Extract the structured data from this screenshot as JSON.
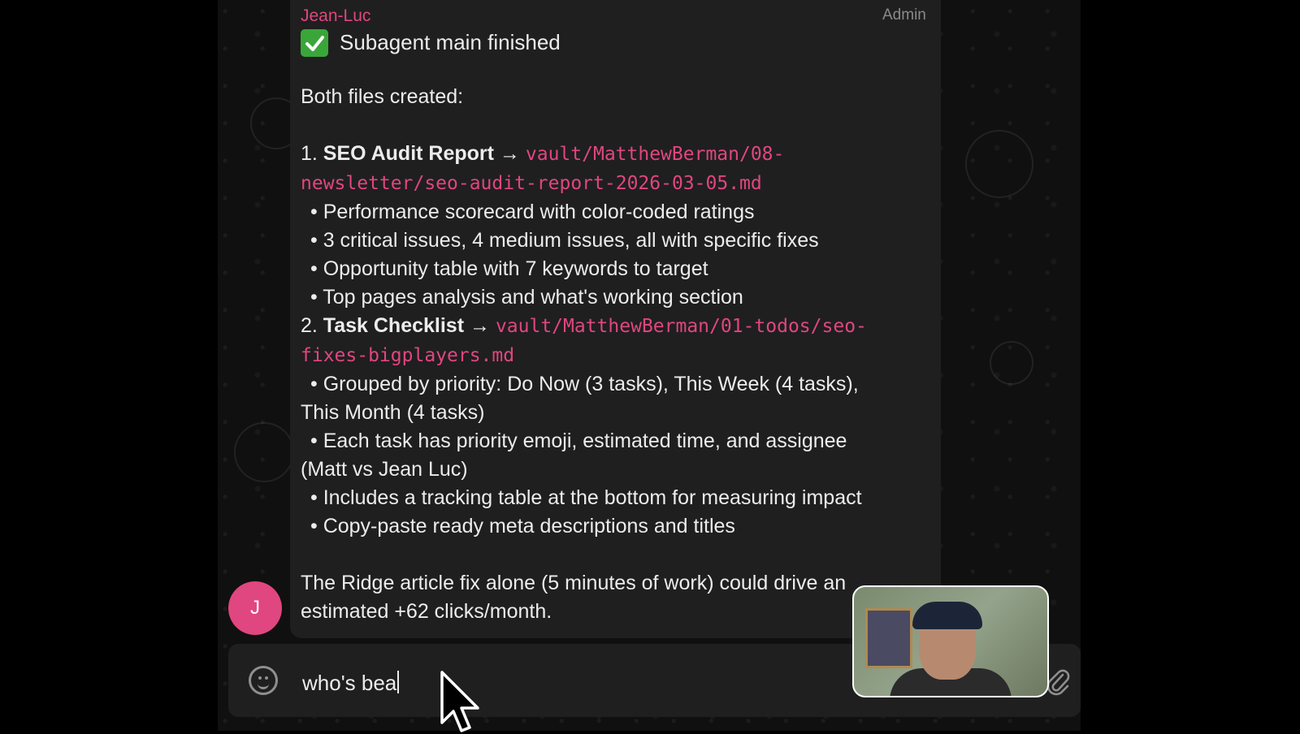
{
  "message": {
    "sender": "Jean-Luc",
    "role": "Admin",
    "status_icon": "check-mark-icon",
    "status_text": "Subagent main finished",
    "intro": "Both files created:",
    "item1_prefix": "1. ",
    "item1_title": "SEO Audit Report",
    "item1_arrow": " → ",
    "item1_path": "vault/MatthewBerman/08-newsletter/seo-audit-report-2026-03-05.md",
    "item1_bullets": [
      "• Performance scorecard with color-coded ratings",
      "• 3 critical issues, 4 medium issues, all with specific fixes",
      "• Opportunity table with 7 keywords to target",
      "• Top pages analysis and what's working section"
    ],
    "item2_prefix": "2. ",
    "item2_title": "Task Checklist",
    "item2_arrow": " → ",
    "item2_path": "vault/MatthewBerman/01-todos/seo-fixes-bigplayers.md",
    "item2_bullet1": "• Grouped by priority: Do Now (3 tasks), This Week (4 tasks),",
    "item2_bullet1_cont": "This Month (4 tasks)",
    "item2_bullet2": "• Each task has priority emoji, estimated time, and assignee",
    "item2_bullet2_cont": "(Matt vs Jean Luc)",
    "item2_bullet3": "• Includes a tracking table at the bottom for measuring impact",
    "item2_bullet4": "• Copy-paste ready meta descriptions and titles",
    "closing_line1": "The Ridge article fix alone (5 minutes of work) could drive an",
    "closing_line2": "estimated +62 clicks/month."
  },
  "avatar": {
    "initial": "J",
    "color": "#e0467f"
  },
  "composer": {
    "emoji_icon": "smile-icon",
    "value": "who's bea",
    "attach_icon": "paperclip-icon"
  },
  "colors": {
    "accent": "#e0467f",
    "bubble": "#1f1f1f",
    "text": "#ececec"
  }
}
